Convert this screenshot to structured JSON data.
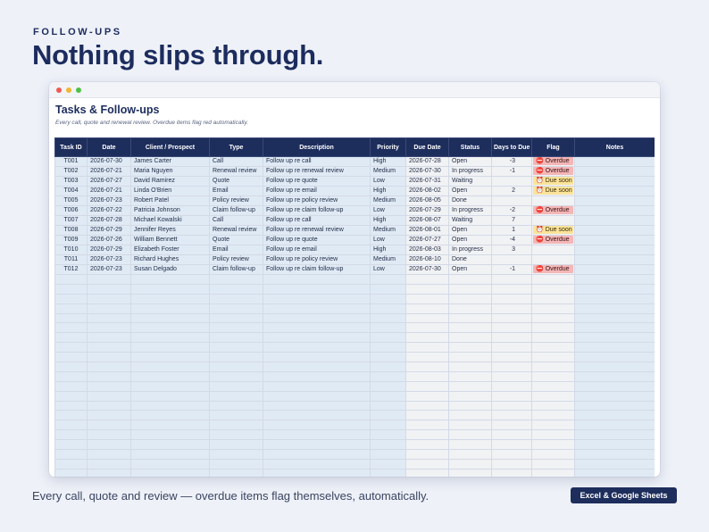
{
  "hero": {
    "eyebrow": "FOLLOW-UPS",
    "headline": "Nothing slips through."
  },
  "sheet": {
    "title": "Tasks & Follow-ups",
    "subtitle": "Every call, quote and renewal review. Overdue items flag red automatically.",
    "columns": [
      "Task ID",
      "Date",
      "Client / Prospect",
      "Type",
      "Description",
      "Priority",
      "Due Date",
      "Status",
      "Days to Due",
      "Flag",
      "Notes"
    ],
    "rows": [
      {
        "id": "T001",
        "date": "2026-07-30",
        "client": "James Carter",
        "type": "Call",
        "desc": "Follow up re call",
        "priority": "High",
        "due": "2026-07-28",
        "status": "Open",
        "days": "-3",
        "flag": "Overdue",
        "flag_kind": "overdue"
      },
      {
        "id": "T002",
        "date": "2026-07-21",
        "client": "Maria Nguyen",
        "type": "Renewal review",
        "desc": "Follow up re renewal review",
        "priority": "Medium",
        "due": "2026-07-30",
        "status": "In progress",
        "days": "-1",
        "flag": "Overdue",
        "flag_kind": "overdue"
      },
      {
        "id": "T003",
        "date": "2026-07-27",
        "client": "David Ramirez",
        "type": "Quote",
        "desc": "Follow up re quote",
        "priority": "Low",
        "due": "2026-07-31",
        "status": "Waiting",
        "days": "",
        "flag": "Due soon",
        "flag_kind": "soon"
      },
      {
        "id": "T004",
        "date": "2026-07-21",
        "client": "Linda O'Brien",
        "type": "Email",
        "desc": "Follow up re email",
        "priority": "High",
        "due": "2026-08-02",
        "status": "Open",
        "days": "2",
        "flag": "Due soon",
        "flag_kind": "soon"
      },
      {
        "id": "T005",
        "date": "2026-07-23",
        "client": "Robert Patel",
        "type": "Policy review",
        "desc": "Follow up re policy review",
        "priority": "Medium",
        "due": "2026-08-05",
        "status": "Done",
        "days": "",
        "flag": "",
        "flag_kind": ""
      },
      {
        "id": "T006",
        "date": "2026-07-22",
        "client": "Patricia Johnson",
        "type": "Claim follow-up",
        "desc": "Follow up re claim follow-up",
        "priority": "Low",
        "due": "2026-07-29",
        "status": "In progress",
        "days": "-2",
        "flag": "Overdue",
        "flag_kind": "overdue"
      },
      {
        "id": "T007",
        "date": "2026-07-28",
        "client": "Michael Kowalski",
        "type": "Call",
        "desc": "Follow up re call",
        "priority": "High",
        "due": "2026-08-07",
        "status": "Waiting",
        "days": "7",
        "flag": "",
        "flag_kind": ""
      },
      {
        "id": "T008",
        "date": "2026-07-29",
        "client": "Jennifer Reyes",
        "type": "Renewal review",
        "desc": "Follow up re renewal review",
        "priority": "Medium",
        "due": "2026-08-01",
        "status": "Open",
        "days": "1",
        "flag": "Due soon",
        "flag_kind": "soon"
      },
      {
        "id": "T009",
        "date": "2026-07-26",
        "client": "William Bennett",
        "type": "Quote",
        "desc": "Follow up re quote",
        "priority": "Low",
        "due": "2026-07-27",
        "status": "Open",
        "days": "-4",
        "flag": "Overdue",
        "flag_kind": "overdue"
      },
      {
        "id": "T010",
        "date": "2026-07-29",
        "client": "Elizabeth Foster",
        "type": "Email",
        "desc": "Follow up re email",
        "priority": "High",
        "due": "2026-08-03",
        "status": "In progress",
        "days": "3",
        "flag": "",
        "flag_kind": ""
      },
      {
        "id": "T011",
        "date": "2026-07-23",
        "client": "Richard Hughes",
        "type": "Policy review",
        "desc": "Follow up re policy review",
        "priority": "Medium",
        "due": "2026-08-10",
        "status": "Done",
        "days": "",
        "flag": "",
        "flag_kind": ""
      },
      {
        "id": "T012",
        "date": "2026-07-23",
        "client": "Susan Delgado",
        "type": "Claim follow-up",
        "desc": "Follow up re claim follow-up",
        "priority": "Low",
        "due": "2026-07-30",
        "status": "Open",
        "days": "-1",
        "flag": "Overdue",
        "flag_kind": "overdue"
      }
    ],
    "empty_row_count": 21
  },
  "icons": {
    "overdue": "no-entry-icon",
    "soon": "alarm-clock-icon"
  },
  "colors": {
    "navy": "#1d2d5c",
    "overdue_fill": "#f4b6b6",
    "soon_fill": "#fbe39a",
    "editable_fill": "#dfeaf5",
    "formula_fill": "#f1f2f4"
  },
  "footer": {
    "caption": "Every call, quote and review — overdue items flag themselves, automatically.",
    "badge": "Excel & Google Sheets"
  }
}
